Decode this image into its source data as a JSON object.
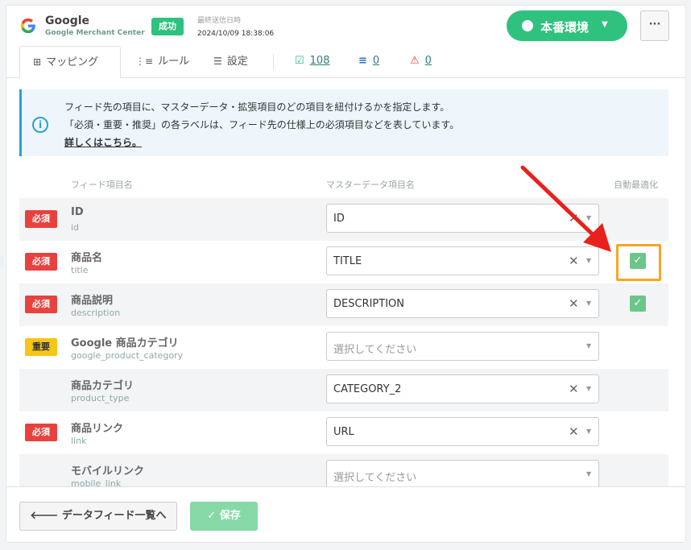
{
  "header": {
    "brand_name": "Google",
    "brand_sub": "Google Merchant Center",
    "status": "成功",
    "last_sent_label": "最終送信日時",
    "last_sent_value": "2024/10/09 18:38:06",
    "env_label": "本番環境",
    "more_label": "···"
  },
  "tabs": {
    "mapping": "マッピング",
    "rule": "ルール",
    "setting": "設定",
    "count_ok": "108",
    "count_warn": "0",
    "count_err": "0"
  },
  "info": {
    "line1": "フィード先の項目に、マスターデータ・拡張項目のどの項目を紐付けるかを指定します。",
    "line2": "「必須・重要・推奨」の各ラベルは、フィード先の仕様上の必須項目などを表しています。",
    "link": "詳しくはこちら。"
  },
  "table": {
    "col_feed": "フィード項目名",
    "col_master": "マスターデータ項目名",
    "col_auto": "自動最適化",
    "rows": [
      {
        "badge": "必須",
        "name": "ID",
        "key": "id",
        "value": "ID"
      },
      {
        "badge": "必須",
        "name": "商品名",
        "key": "title",
        "value": "TITLE"
      },
      {
        "badge": "必須",
        "name": "商品説明",
        "key": "description",
        "value": "DESCRIPTION"
      },
      {
        "badge": "重要",
        "name": "Google 商品カテゴリ",
        "key": "google_product_category",
        "value": "選択してください"
      },
      {
        "badge": "",
        "name": "商品カテゴリ",
        "key": "product_type",
        "value": "CATEGORY_2"
      },
      {
        "badge": "必須",
        "name": "商品リンク",
        "key": "link",
        "value": "URL"
      },
      {
        "badge": "",
        "name": "モバイルリンク",
        "key": "mobile_link",
        "value": "選択してください"
      }
    ]
  },
  "footer": {
    "back_label": "データフィード一覧へ",
    "save_label": "保存"
  },
  "colors": {
    "accent_green": "#2ec27e",
    "required_red": "#e8423f",
    "important_yellow": "#f5c518",
    "highlight_orange": "#f5a623",
    "arrow_red": "#e8211c"
  }
}
